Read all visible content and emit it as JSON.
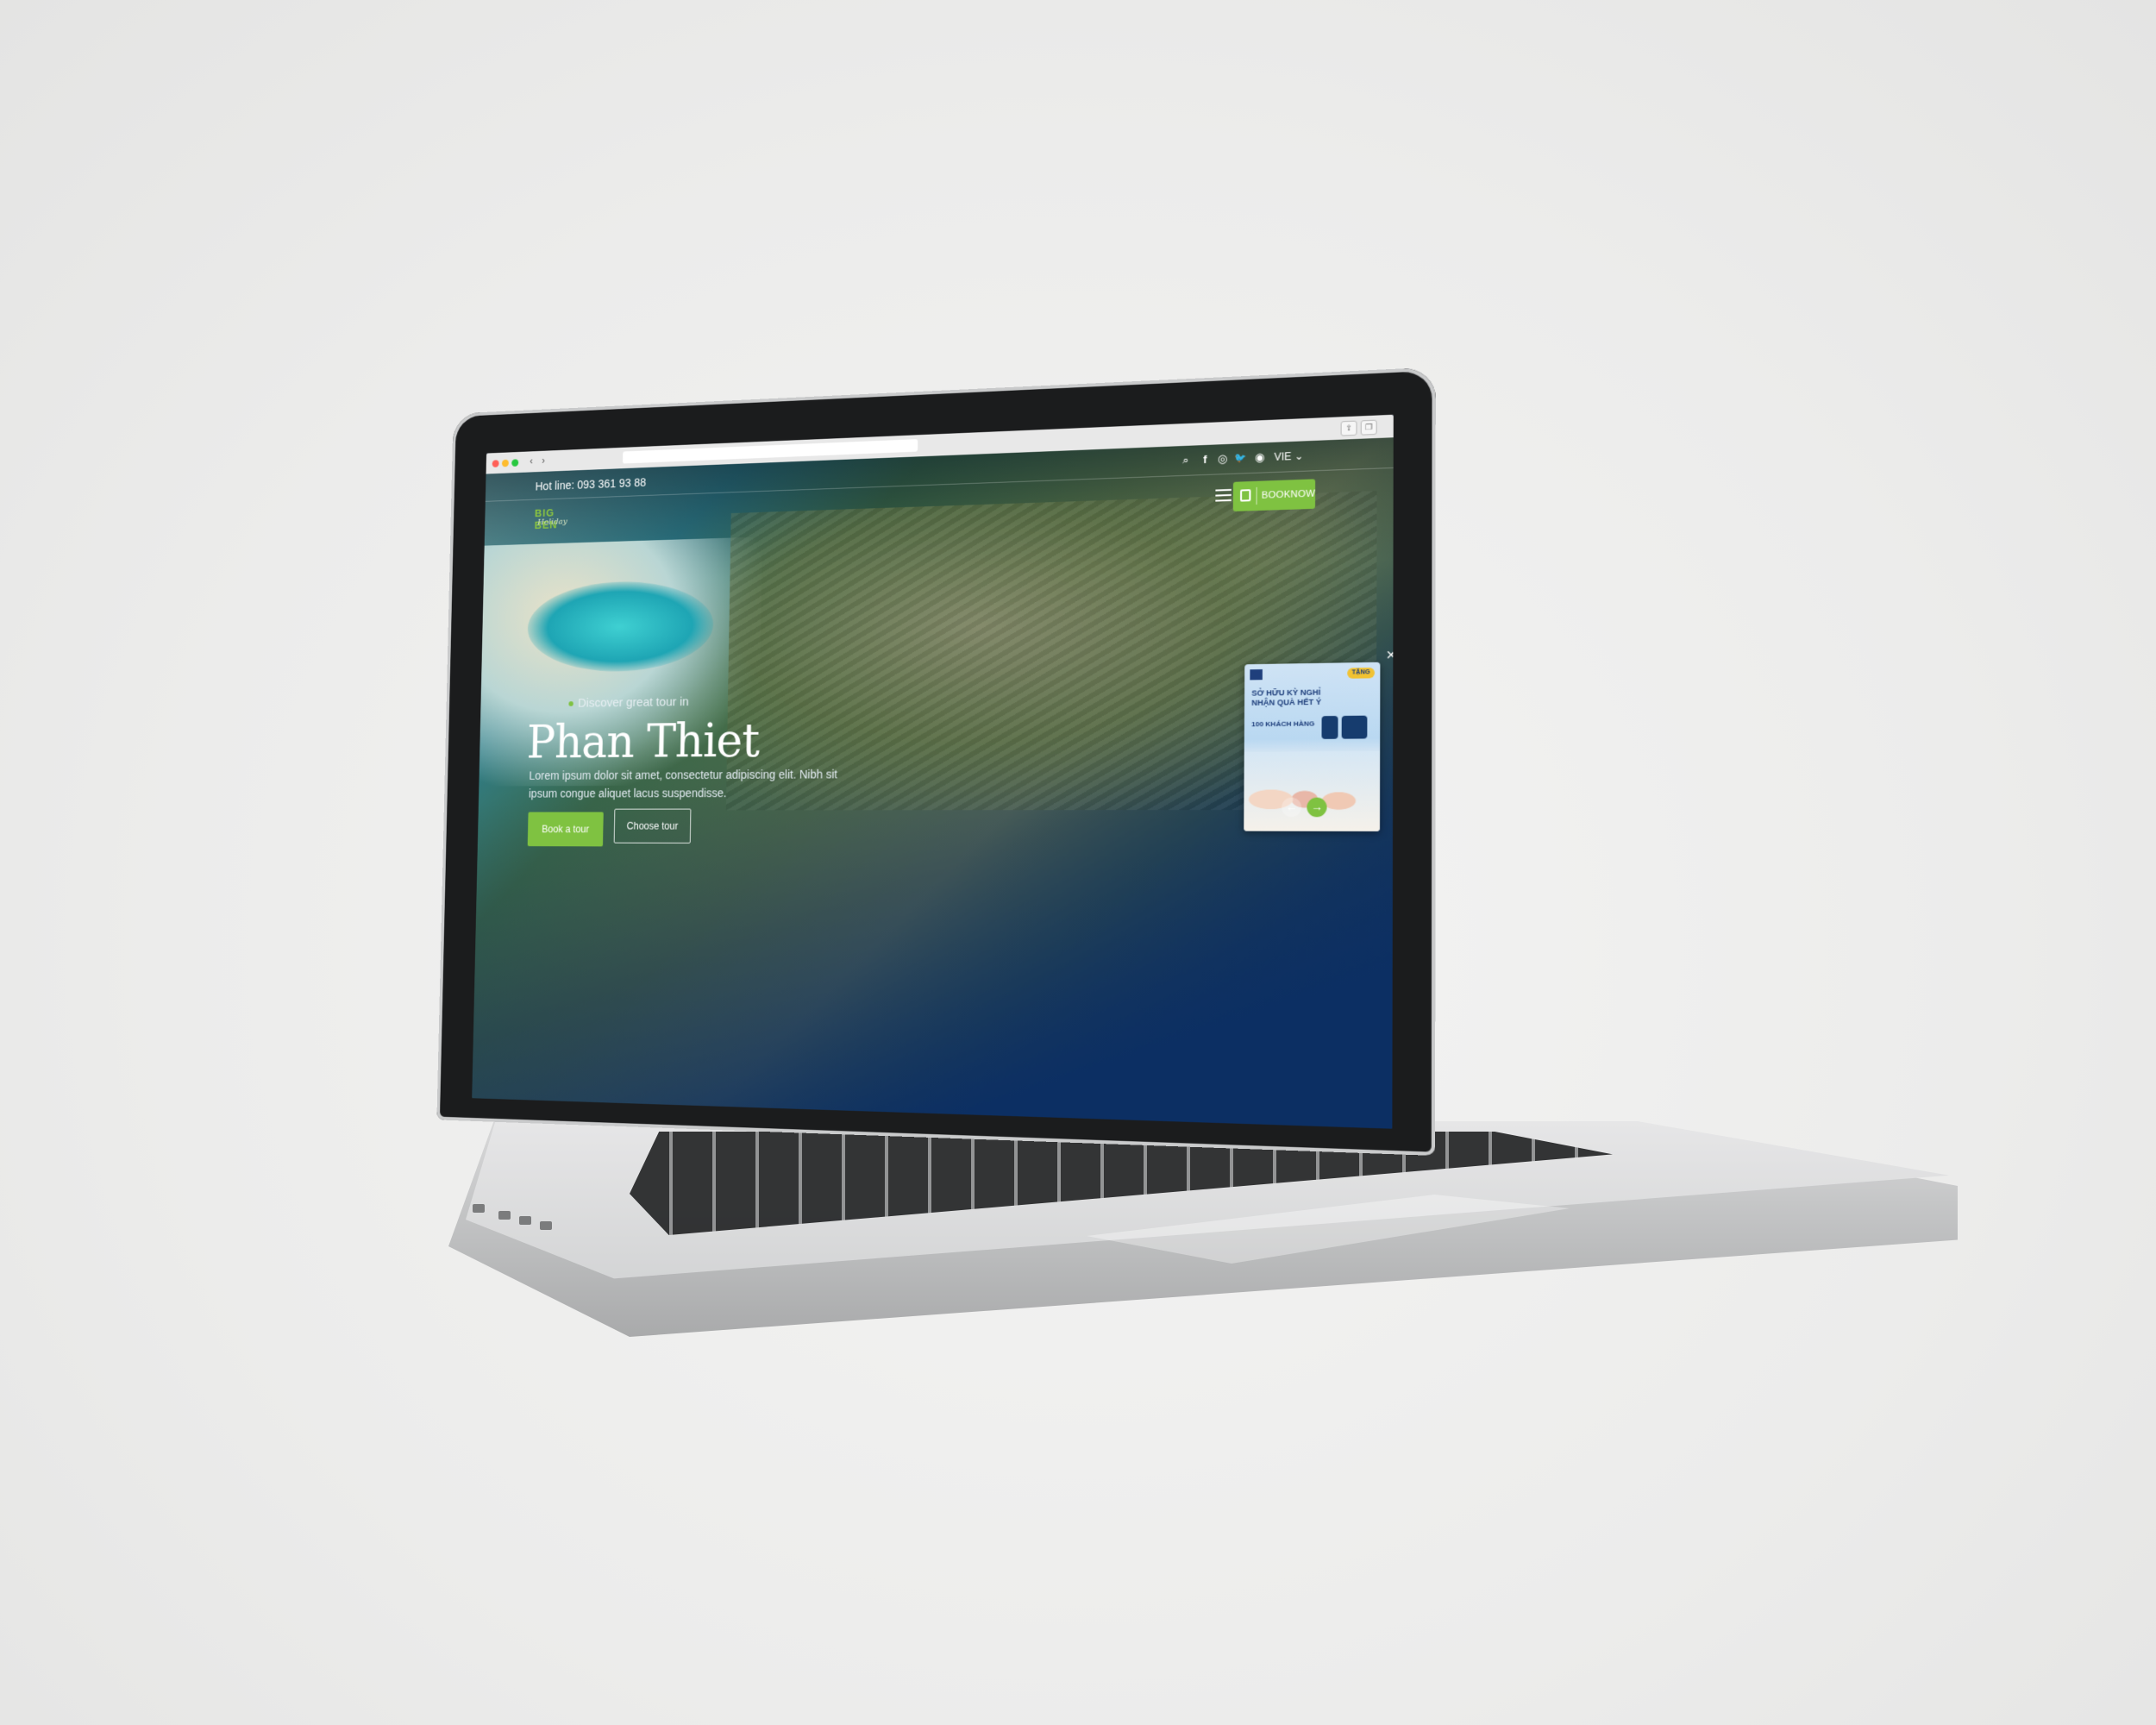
{
  "browser": {
    "back_glyph": "‹",
    "forward_glyph": "›",
    "share_glyph": "⇪",
    "tabs_glyph": "❐"
  },
  "topbar": {
    "hotline": "Hot line: 093 361 93 88",
    "language": "VIE ⌄",
    "icons": [
      "search-icon",
      "facebook-icon",
      "instagram-icon",
      "twitter-icon",
      "user-icon"
    ],
    "icon_glyphs": {
      "search": "⌕",
      "facebook": "f",
      "instagram": "◎",
      "twitter": "🐦",
      "user": "◉"
    }
  },
  "header": {
    "logo_main": "BIG BEN",
    "logo_sub": "Holiday",
    "booknow_label": "BOOKNOW"
  },
  "hero": {
    "eyebrow": "Discover great tour in",
    "title": "Phan Thiet",
    "description": "Lorem ipsum dolor sit amet, consectetur adipiscing elit. Nibh sit ipsum congue aliquet lacus suspendisse.",
    "book_button": "Book a tour",
    "choose_button": "Choose tour"
  },
  "promo": {
    "badge": "TẶNG",
    "headline": "SỞ HỮU KỲ NGHỈ NHẬN QUÀ HẾT Ý",
    "count_text": "100 KHÁCH HÀNG",
    "close_glyph": "✕"
  },
  "slider": {
    "prev_glyph": "←",
    "next_glyph": "→"
  },
  "colors": {
    "accent_green": "#7fc241",
    "deep_blue": "#0c2f63"
  }
}
